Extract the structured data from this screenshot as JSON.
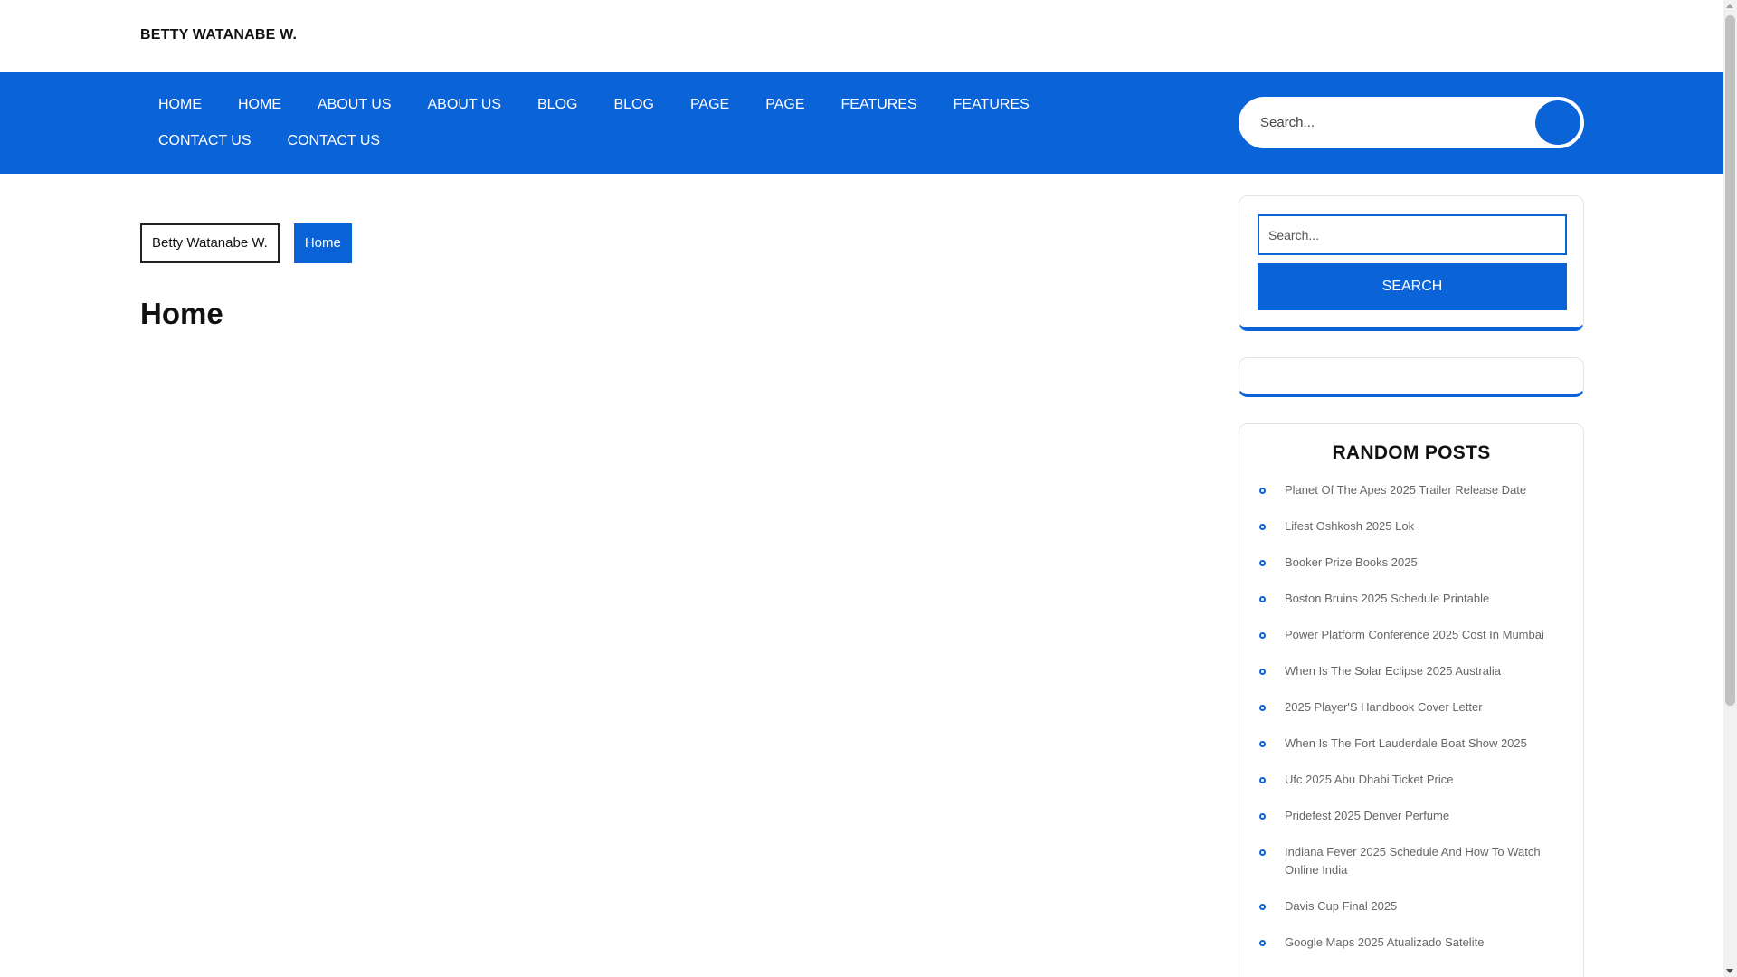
{
  "site": {
    "title": "BETTY WATANABE W."
  },
  "nav": {
    "items": [
      "HOME",
      "HOME",
      "ABOUT US",
      "ABOUT US",
      "BLOG",
      "BLOG",
      "PAGE",
      "PAGE",
      "FEATURES",
      "FEATURES",
      "CONTACT US",
      "CONTACT US"
    ],
    "search_placeholder": "Search..."
  },
  "breadcrumb": {
    "home": "Betty Watanabe W.",
    "current": "Home"
  },
  "page": {
    "title": "Home"
  },
  "sidebar": {
    "search": {
      "placeholder": "Search...",
      "button": "SEARCH"
    },
    "random_posts": {
      "title": "RANDOM POSTS",
      "items": [
        "Planet Of The Apes 2025 Trailer Release Date",
        "Lifest Oshkosh 2025 Lok",
        "Booker Prize Books 2025",
        "Boston Bruins 2025 Schedule Printable",
        "Power Platform Conference 2025 Cost In Mumbai",
        "When Is The Solar Eclipse 2025 Australia",
        "2025 Player'S Handbook Cover Letter",
        "When Is The Fort Lauderdale Boat Show 2025",
        "Ufc 2025 Abu Dhabi Ticket Price",
        "Pridefest 2025 Denver Perfume",
        "Indiana Fever 2025 Schedule And How To Watch Online India",
        "Davis Cup Final 2025",
        "Google Maps 2025 Atualizado Satelite"
      ]
    }
  },
  "colors": {
    "accent": "#0b63d8"
  }
}
